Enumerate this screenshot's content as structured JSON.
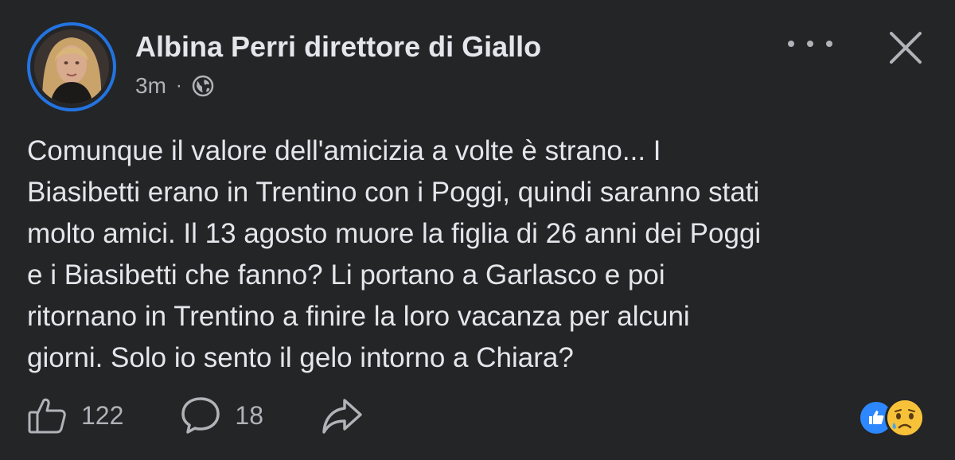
{
  "post": {
    "author_name": "Albina Perri direttore di Giallo",
    "timestamp": "3m",
    "separator": "·",
    "audience_icon": "globe-icon",
    "body_lines": [
      "Comunque il valore dell'amicizia a volte è strano... I",
      "Biasibetti erano in Trentino con i Poggi, quindi saranno stati",
      "molto amici. Il 13 agosto muore la figlia di 26 anni dei Poggi",
      "e i Biasibetti che fanno? Li portano a Garlasco e poi",
      "ritornano in Trentino a finire la loro vacanza per alcuni",
      "giorni. Solo io sento il gelo intorno a Chiara?"
    ],
    "like_count": "122",
    "comment_count": "18",
    "reactions": [
      "like-reaction-icon",
      "sad-reaction-icon"
    ]
  },
  "colors": {
    "background": "#242527",
    "text_primary": "#e4e6eb",
    "text_secondary": "#b0b3b8",
    "accent": "#2374e1"
  }
}
